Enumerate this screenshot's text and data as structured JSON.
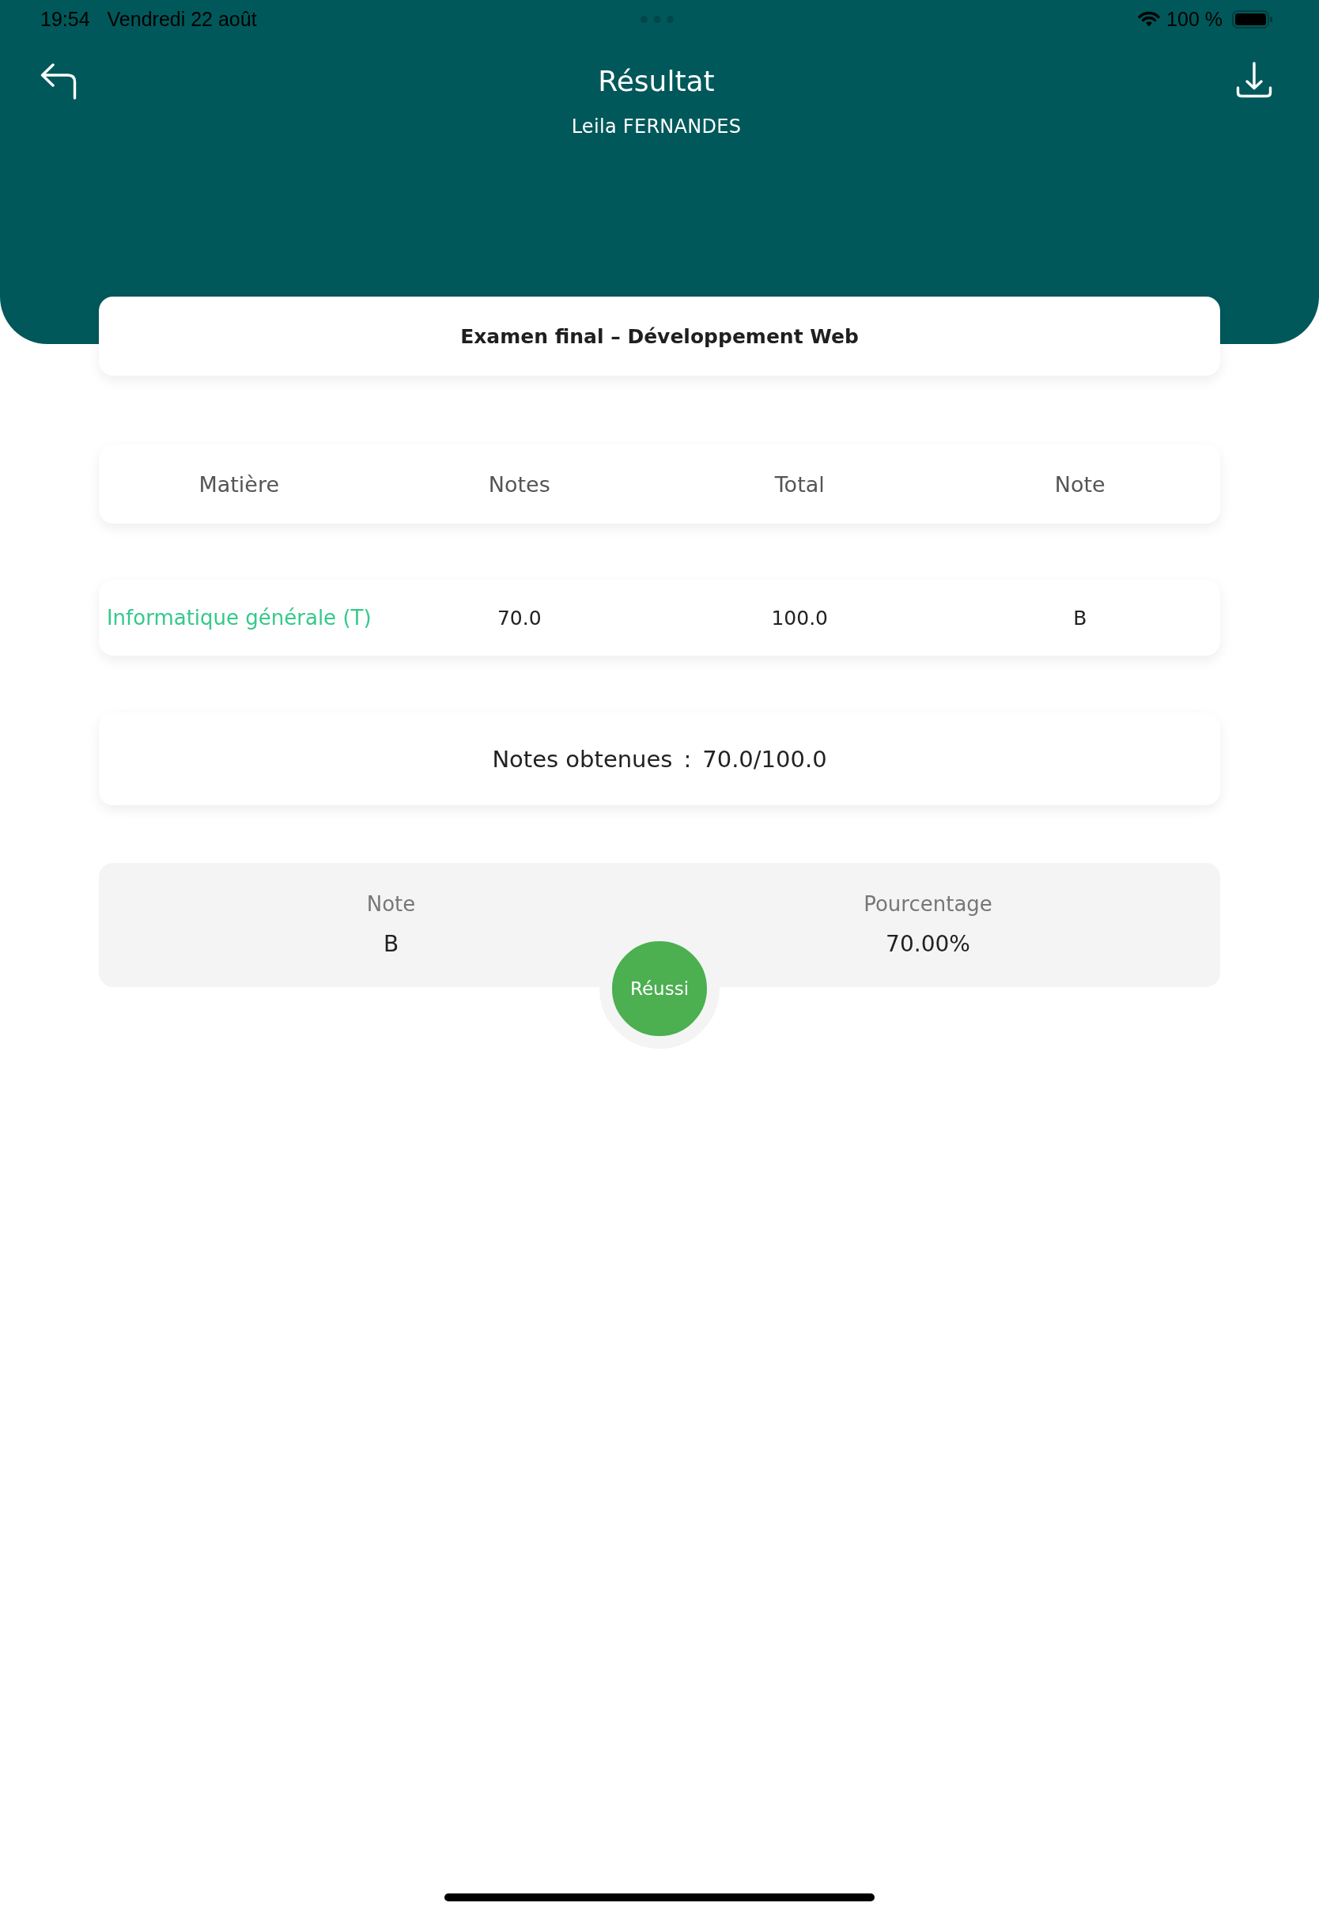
{
  "status_bar": {
    "time": "19:54",
    "date": "Vendredi 22 août",
    "battery": "100 %"
  },
  "header": {
    "title": "Résultat",
    "subtitle": "Leila FERNANDES"
  },
  "exam": {
    "title": "Examen final – Développement Web"
  },
  "table": {
    "columns": [
      "Matière",
      "Notes",
      "Total",
      "Note"
    ],
    "rows": [
      [
        "Informatique générale (T)",
        "70.0",
        "100.0",
        "B"
      ]
    ]
  },
  "total": {
    "label": "Notes obtenues",
    "separator": ":",
    "value": "70.0/100.0"
  },
  "summary": {
    "items": [
      {
        "label": "Note",
        "value": "B"
      },
      {
        "label": "Pourcentage",
        "value": "70.00%"
      }
    ],
    "result": {
      "label": "Réussi",
      "passed": true
    }
  }
}
